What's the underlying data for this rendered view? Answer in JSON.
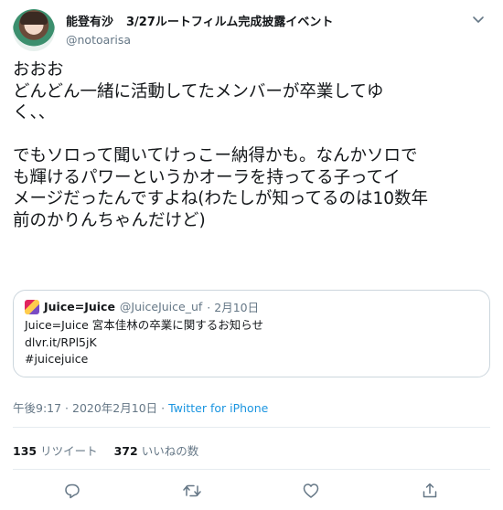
{
  "tweet": {
    "display_name": "能登有沙",
    "name_suffix": "3/27ルートフィルム完成披露イベント",
    "handle": "@notoarisa",
    "text_lines": [
      "おおお",
      "どんどん一緒に活動してたメンバーが卒業してゆ",
      "く、、",
      "",
      "でもソロって聞いてけっこー納得かも。なんかソロで",
      "も輝けるパワーというかオーラを持ってる子ってイ",
      "メージだったんですよね(わたしが知ってるのは10数年",
      "前のかりんちゃんだけど)"
    ],
    "timestamp": "午後9:17 · 2020年2月10日 ·",
    "source": "Twitter for iPhone"
  },
  "quote": {
    "name": "Juice=Juice",
    "handle": "@JuiceJuice_uf",
    "date": "· 2月10日",
    "lines": [
      "Juice=Juice 宮本佳林の卒業に関するお知らせ",
      "dlvr.it/RPl5jK",
      "#juicejuice"
    ]
  },
  "stats": {
    "retweets_count": "135",
    "retweets_label": "リツイート",
    "likes_count": "372",
    "likes_label": "いいねの数"
  },
  "icons": {
    "menu": "chevron-down-icon",
    "reply": "reply-icon",
    "retweet": "retweet-icon",
    "like": "heart-icon",
    "share": "share-icon"
  },
  "colors": {
    "text": "#14171a",
    "secondary": "#657786",
    "link": "#1b95e0",
    "border": "#ccd6dd"
  }
}
